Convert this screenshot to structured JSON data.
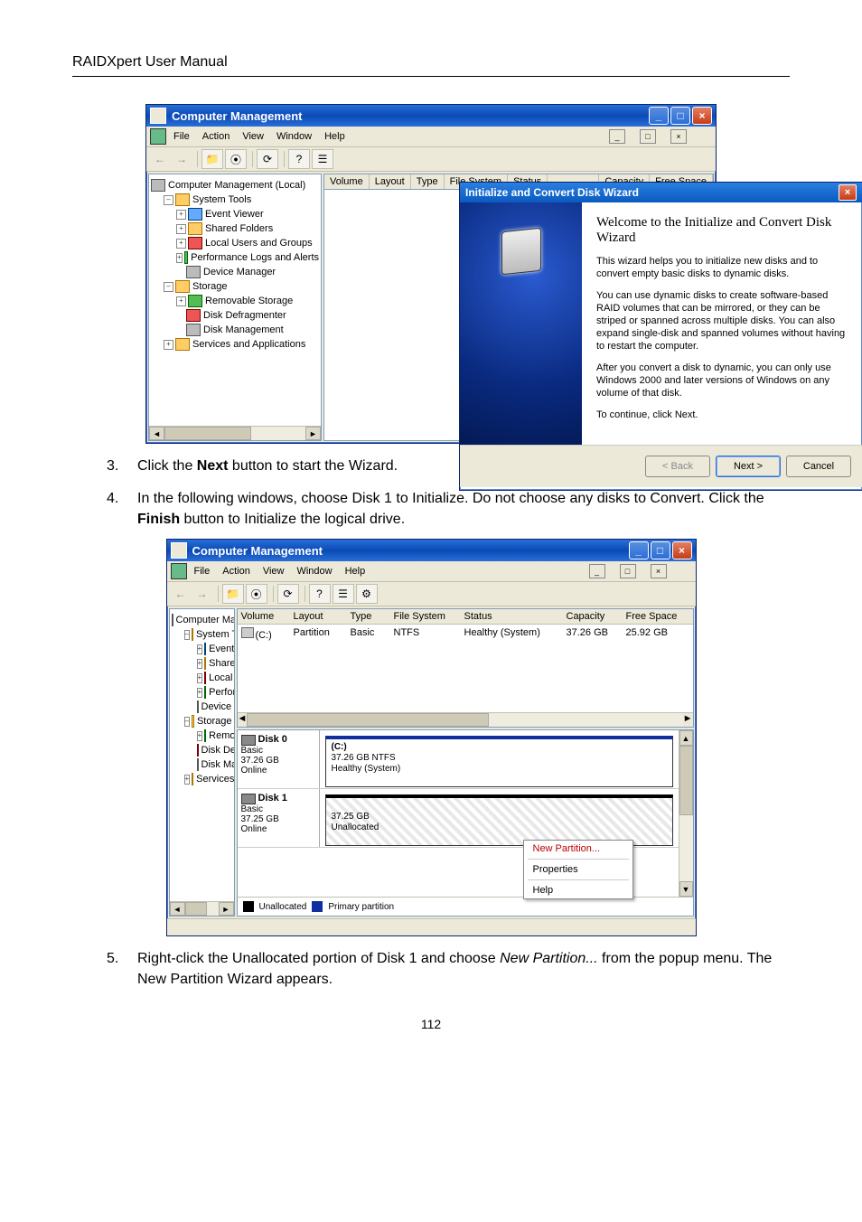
{
  "doc": {
    "header": "RAIDXpert User Manual",
    "page_number": "112",
    "step3_num": "3.",
    "step3_text_a": "Click the ",
    "step3_bold": "Next",
    "step3_text_b": " button to start the Wizard.",
    "step4_num": "4.",
    "step4_text_a": "In the following windows, choose Disk 1 to Initialize. Do not choose any disks to Convert. Click the ",
    "step4_bold": "Finish",
    "step4_text_b": " button to Initialize the logical drive.",
    "step5_num": "5.",
    "step5_text_a": "Right-click the Unallocated portion of Disk 1 and choose ",
    "step5_italic": "New Partition...",
    "step5_text_b": " from the popup menu. The New Partition Wizard appears."
  },
  "shot1": {
    "title": "Computer Management",
    "menu": {
      "file": "File",
      "action": "Action",
      "view": "View",
      "window": "Window",
      "help": "Help"
    },
    "tree": {
      "root": "Computer Management (Local)",
      "systools": "System Tools",
      "ev": "Event Viewer",
      "sf": "Shared Folders",
      "lug": "Local Users and Groups",
      "pla": "Performance Logs and Alerts",
      "dm": "Device Manager",
      "storage": "Storage",
      "rs": "Removable Storage",
      "dd": "Disk Defragmenter",
      "dmg": "Disk Management",
      "sa": "Services and Applications"
    },
    "cols": {
      "volume": "Volume",
      "layout": "Layout",
      "type": "Type",
      "fs": "File System",
      "status": "Status",
      "cap": "Capacity",
      "free": "Free Space"
    },
    "wizard": {
      "title": "Initialize and Convert Disk Wizard",
      "heading": "Welcome to the Initialize and Convert Disk Wizard",
      "p1": "This wizard helps you to initialize new disks and to convert empty basic disks to dynamic disks.",
      "p2": "You can use dynamic disks to create software-based RAID volumes that can be mirrored, or they can be striped or spanned across multiple disks. You can also expand single-disk and spanned volumes without having to restart the computer.",
      "p3": "After you convert a disk to dynamic, you can only use Windows 2000 and later versions of Windows on any volume of that disk.",
      "p4": "To continue, click Next.",
      "back": "< Back",
      "next": "Next >",
      "cancel": "Cancel"
    }
  },
  "shot2": {
    "title": "Computer Management",
    "menu": {
      "file": "File",
      "action": "Action",
      "view": "View",
      "window": "Window",
      "help": "Help"
    },
    "tree": {
      "root": "Computer Management (Local)",
      "systools": "System Tools",
      "ev": "Event Viewer",
      "sf": "Shared Folders",
      "lug": "Local Users and Groups",
      "pla": "Performance Logs and Alerts",
      "dm": "Device Manager",
      "storage": "Storage",
      "rs": "Removable Storage",
      "dd": "Disk Defragmenter",
      "dmg": "Disk Management",
      "sa": "Services and Applications"
    },
    "cols": {
      "volume": "Volume",
      "layout": "Layout",
      "type": "Type",
      "fs": "File System",
      "status": "Status",
      "cap": "Capacity",
      "free": "Free Space"
    },
    "vol": {
      "name": "(C:)",
      "layout": "Partition",
      "type": "Basic",
      "fs": "NTFS",
      "status": "Healthy (System)",
      "cap": "37.26 GB",
      "free": "25.92 GB"
    },
    "disk0": {
      "title": "Disk 0",
      "kind": "Basic",
      "size": "37.26 GB",
      "state": "Online",
      "part_label": "(C:)",
      "part_size": "37.26 GB NTFS",
      "part_status": "Healthy (System)"
    },
    "disk1": {
      "title": "Disk 1",
      "kind": "Basic",
      "size": "37.25 GB",
      "state": "Online",
      "part_size": "37.25 GB",
      "part_status": "Unallocated"
    },
    "legend": {
      "unalloc": "Unallocated",
      "primary": "Primary partition"
    },
    "popup": {
      "np": "New Partition...",
      "props": "Properties",
      "help": "Help"
    }
  }
}
